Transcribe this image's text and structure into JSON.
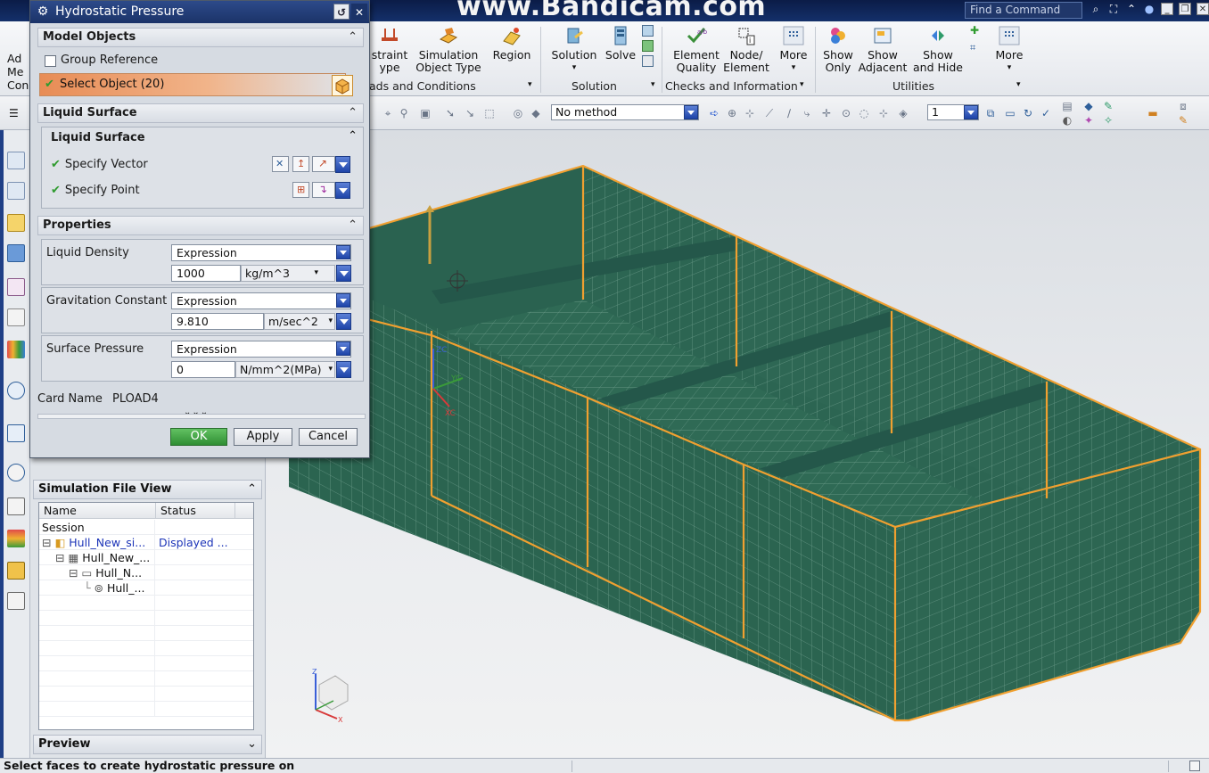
{
  "titlebar": {
    "watermark": "www.Bandicam.com",
    "dialog_title": "Hydrostatic Pressure",
    "find_command_placeholder": "Find a Command"
  },
  "ribbon": {
    "left_partial": [
      "Ad",
      "Me",
      "Con"
    ],
    "buttons": [
      {
        "line1": "straint",
        "line2": "ype"
      },
      {
        "line1": "Simulation",
        "line2": "Object Type"
      },
      {
        "line1": "Region",
        "line2": ""
      },
      {
        "line1": "Solution",
        "line2": ""
      },
      {
        "line1": "Solve",
        "line2": ""
      },
      {
        "line1": "Element",
        "line2": "Quality"
      },
      {
        "line1": "Node/",
        "line2": "Element"
      },
      {
        "line1": "More",
        "line2": ""
      },
      {
        "line1": "Show",
        "line2": "Only"
      },
      {
        "line1": "Show",
        "line2": "Adjacent"
      },
      {
        "line1": "Show",
        "line2": "and Hide"
      },
      {
        "line1": "More",
        "line2": ""
      }
    ],
    "groups": [
      "ads and Conditions",
      "Solution",
      "Checks and Information",
      "Utilities"
    ]
  },
  "cmdbar": {
    "method_value": "No method",
    "layer_value": "1"
  },
  "dialog": {
    "model_objects": {
      "header": "Model Objects",
      "group_reference": "Group Reference",
      "select_object": "Select Object (20)"
    },
    "liquid_surface": {
      "header": "Liquid Surface",
      "inner_header": "Liquid Surface",
      "specify_vector": "Specify Vector",
      "specify_point": "Specify Point"
    },
    "properties": {
      "header": "Properties",
      "liquid_density": {
        "label": "Liquid Density",
        "mode": "Expression",
        "value": "1000",
        "unit": "kg/m^3"
      },
      "gravitation": {
        "label": "Gravitation Constant",
        "mode": "Expression",
        "value": "9.810",
        "unit": "m/sec^2"
      },
      "surface_pressure": {
        "label": "Surface Pressure",
        "mode": "Expression",
        "value": "0",
        "unit": "N/mm^2(MPa)"
      }
    },
    "card_name_label": "Card Name",
    "card_name_value": "PLOAD4",
    "ok": "OK",
    "apply": "Apply",
    "cancel": "Cancel"
  },
  "navigator": {
    "header": "Simulation File View",
    "columns": [
      "Name",
      "Status"
    ],
    "rows": [
      {
        "name": "Session",
        "status": ""
      },
      {
        "name": "Hull_New_si...",
        "status": "Displayed ..."
      },
      {
        "name": "Hull_New_...",
        "status": ""
      },
      {
        "name": "Hull_N...",
        "status": ""
      },
      {
        "name": "Hull_...",
        "status": ""
      }
    ],
    "preview": "Preview"
  },
  "viewport": {
    "csys_labels": {
      "z": "ZC",
      "y": "YC",
      "x": "XC"
    },
    "triad_labels": {
      "z": "Z",
      "x": "X"
    }
  },
  "status_bar": {
    "message": "Select faces to create hydrostatic pressure on"
  },
  "colors": {
    "hull_face": "#2f6a55",
    "hull_face_dark": "#25584a",
    "mesh_line": "#6a9a88",
    "edge_highlight": "#f0a030",
    "title_blue": "#1b3368",
    "ok_green": "#3a9a3e"
  }
}
